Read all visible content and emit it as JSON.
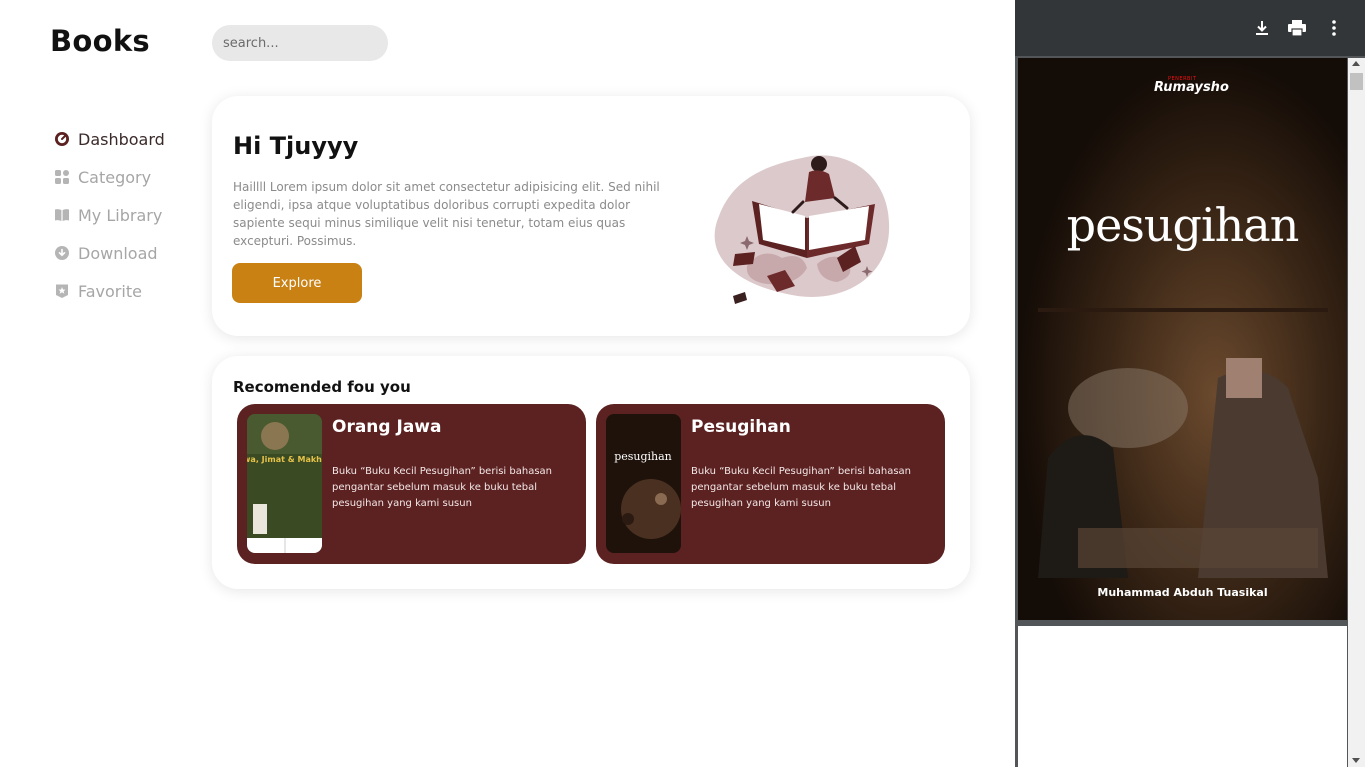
{
  "app": {
    "title": "Books"
  },
  "search": {
    "placeholder": "search..."
  },
  "sidebar": {
    "items": [
      {
        "label": "Dashboard",
        "icon": "dashboard-gauge-icon",
        "active": true
      },
      {
        "label": "Category",
        "icon": "category-grid-icon",
        "active": false
      },
      {
        "label": "My Library",
        "icon": "book-open-icon",
        "active": false
      },
      {
        "label": "Download",
        "icon": "cloud-download-icon",
        "active": false
      },
      {
        "label": "Favorite",
        "icon": "star-badge-icon",
        "active": false
      }
    ]
  },
  "hero": {
    "greeting": "Hi Tjuyyy",
    "text": "Haillll Lorem ipsum dolor sit amet consectetur adipisicing elit. Sed nihil eligendi, ipsa atque voluptatibus doloribus corrupti expedita dolor sapiente sequi minus similique velit nisi tenetur, totam eius quas excepturi. Possimus.",
    "button_label": "Explore"
  },
  "recommended": {
    "title": "Recomended fou you",
    "books": [
      {
        "title": "Orang Jawa",
        "description": "Buku “Buku Kecil Pesugihan” berisi bahasan pengantar sebelum masuk ke buku tebal pesugihan yang kami susun",
        "cover_text": "Orang Jawa, Jimat & Makhluk Halus"
      },
      {
        "title": "Pesugihan",
        "description": "Buku “Buku Kecil Pesugihan” berisi bahasan pengantar sebelum masuk ke buku tebal pesugihan yang kami susun",
        "cover_text": "pesugihan"
      }
    ]
  },
  "viewer": {
    "publisher_small": "PENERBIT",
    "publisher": "Rumaysho",
    "title": "pesugihan",
    "author": "Muhammad Abduh Tuasikal"
  },
  "colors": {
    "accent": "#c98113",
    "card": "#5c2121",
    "viewer_toolbar": "#323639"
  }
}
